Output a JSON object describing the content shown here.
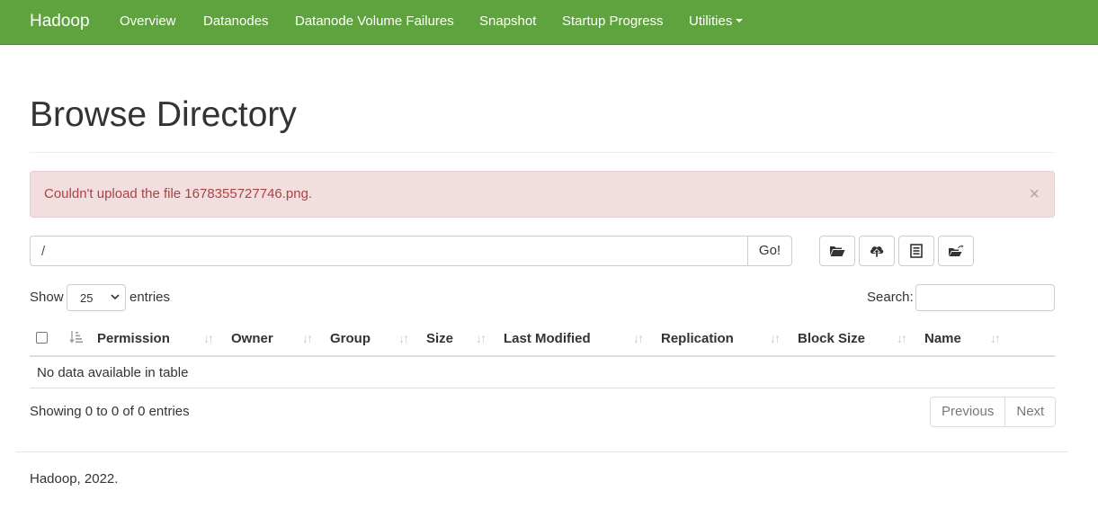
{
  "navbar": {
    "brand": "Hadoop",
    "items": [
      {
        "label": "Overview"
      },
      {
        "label": "Datanodes"
      },
      {
        "label": "Datanode Volume Failures"
      },
      {
        "label": "Snapshot"
      },
      {
        "label": "Startup Progress"
      },
      {
        "label": "Utilities"
      }
    ],
    "color": "#5fa33e"
  },
  "page": {
    "title": "Browse Directory"
  },
  "alert": {
    "message": "Couldn't upload the file 1678355727746.png.",
    "close": "×"
  },
  "path_bar": {
    "value": "/",
    "go_label": "Go!"
  },
  "toolbar": {
    "icons": [
      "open-folder-icon",
      "cloud-upload-icon",
      "list-icon",
      "move-folder-icon"
    ]
  },
  "table_controls": {
    "show_label": "Show",
    "page_length": "25",
    "entries_label": "entries",
    "search_label": "Search:",
    "search_value": ""
  },
  "table": {
    "columns": [
      "Permission",
      "Owner",
      "Group",
      "Size",
      "Last Modified",
      "Replication",
      "Block Size",
      "Name"
    ],
    "empty_message": "No data available in table"
  },
  "pagination": {
    "info": "Showing 0 to 0 of 0 entries",
    "previous": "Previous",
    "next": "Next"
  },
  "footer": {
    "text": "Hadoop, 2022."
  }
}
